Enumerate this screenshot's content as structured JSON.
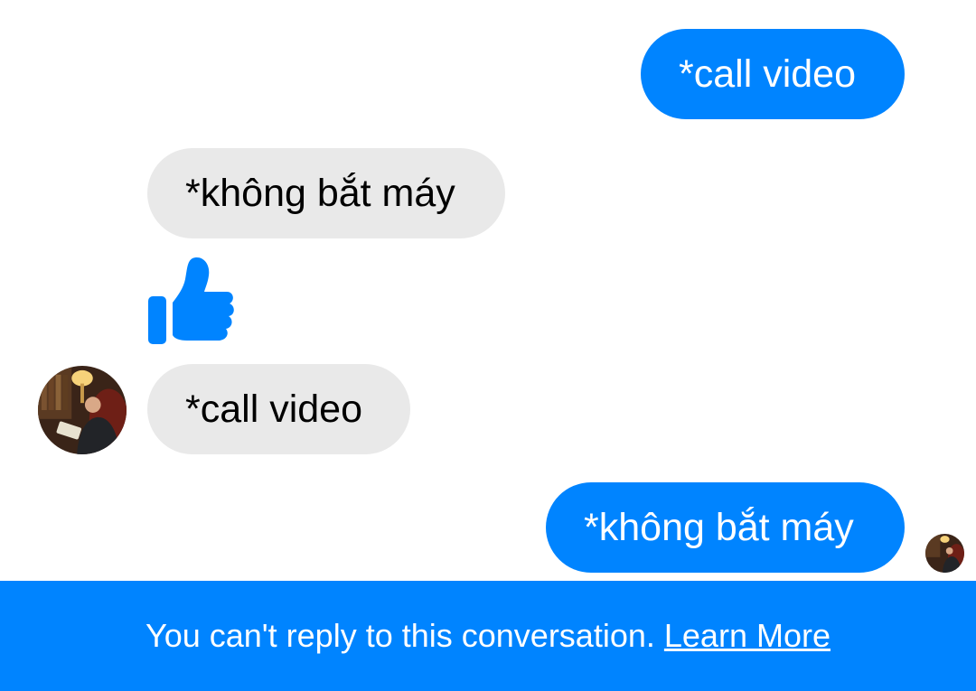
{
  "messages": [
    {
      "direction": "outgoing",
      "text": "*call video"
    },
    {
      "direction": "incoming",
      "text": "*không bắt máy"
    },
    {
      "direction": "incoming",
      "icon": "thumbs-up-icon"
    },
    {
      "direction": "incoming",
      "text": "*call video"
    },
    {
      "direction": "outgoing",
      "text": "*không bắt máy"
    }
  ],
  "banner": {
    "text": "You can't reply to this conversation.",
    "link_label": "Learn More"
  },
  "colors": {
    "accent": "#0084ff",
    "incoming_bubble": "#e9e9e9",
    "incoming_text": "#000000",
    "outgoing_text": "#ffffff"
  }
}
